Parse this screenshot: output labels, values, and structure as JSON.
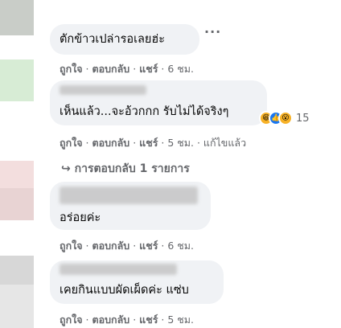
{
  "comments": [
    {
      "text": "ตักข้าวเปล่ารอเลยฮ่ะ",
      "more": "···",
      "like": "ถูกใจ",
      "reply": "ตอบกลับ",
      "share": "แชร์",
      "time": "6 ชม."
    },
    {
      "text": "เห็นแล้ว...จะอ้วกกก รับไม่ได้จริงๆ",
      "reaction_count": "15",
      "like": "ถูกใจ",
      "reply": "ตอบกลับ",
      "share": "แชร์",
      "time": "5 ชม.",
      "edited": "แก้ไขแล้ว",
      "replies_link": "การตอบกลับ 1 รายการ"
    },
    {
      "text": "อร่อยค่ะ",
      "like": "ถูกใจ",
      "reply": "ตอบกลับ",
      "share": "แชร์",
      "time": "6 ชม."
    },
    {
      "text": "เคยกินแบบผัดเผ็ดค่ะ แซ่บ",
      "like": "ถูกใจ",
      "reply": "ตอบกลับ",
      "share": "แชร์",
      "time": "5 ชม."
    }
  ],
  "colors": {
    "bubble": "#f0f2f5",
    "meta": "#65676b",
    "like_blue": "#1877f2",
    "haha_yellow": "#f7b125"
  },
  "icons": [
    "more-icon",
    "haha-reaction-icon",
    "like-reaction-icon",
    "wow-reaction-icon",
    "reply-arrow-icon"
  ]
}
